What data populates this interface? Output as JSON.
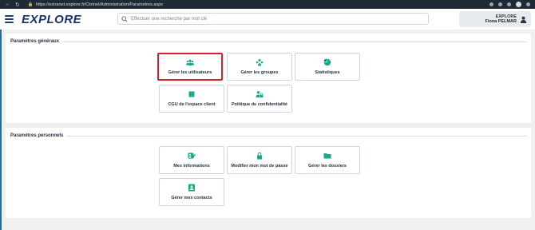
{
  "browser": {
    "url": "https://extranet.explore.fr/Clotnet/Administration/Parametres.aspx"
  },
  "header": {
    "logo": "EXPLORE",
    "search_placeholder": "Effectuer une recherche par mot clé",
    "user_company": "EXPLORE",
    "user_name": "Fiona PELMAR"
  },
  "general": {
    "title": "Paramètres généraux",
    "tiles": [
      {
        "label": "Gérer les utilisateurs",
        "icon": "users-icon"
      },
      {
        "label": "Gérer les groupes",
        "icon": "groups-icon"
      },
      {
        "label": "Statistiques",
        "icon": "pie-chart-icon"
      },
      {
        "label": "CGU de l'espace client",
        "icon": "book-icon"
      },
      {
        "label": "Politique de confidentialité",
        "icon": "user-lock-icon"
      }
    ]
  },
  "personal": {
    "title": "Paramètres personnels",
    "tiles": [
      {
        "label": "Mes informations",
        "icon": "edit-card-icon"
      },
      {
        "label": "Modifier mon mot de passe",
        "icon": "lock-icon"
      },
      {
        "label": "Gérer les dossiers",
        "icon": "folder-icon"
      },
      {
        "label": "Gérer mes contacts",
        "icon": "contacts-icon"
      }
    ]
  },
  "colors": {
    "accent": "#1aa88a",
    "brand": "#17316a",
    "highlight": "#d6202a"
  }
}
